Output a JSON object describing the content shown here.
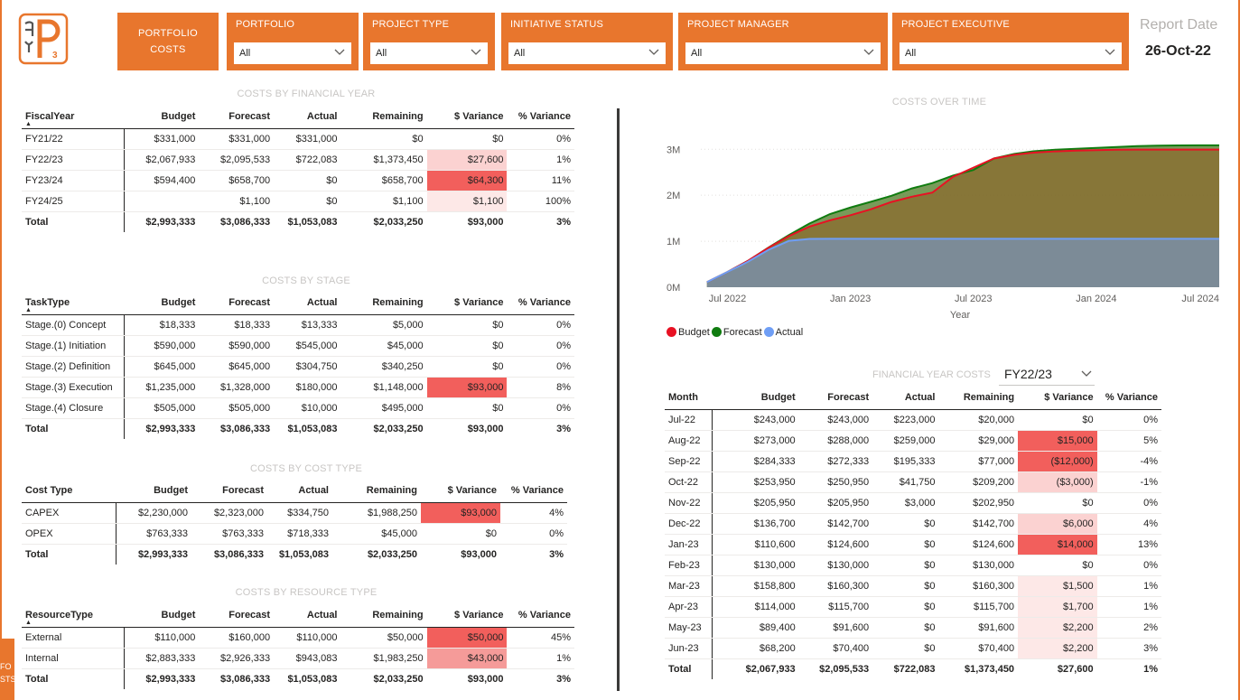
{
  "logo": {
    "text": "myP3",
    "icon": "myp3-logo-icon"
  },
  "header": {
    "portfolio_costs_line1": "PORTFOLIO",
    "portfolio_costs_line2": "COSTS",
    "filters": [
      {
        "label": "PORTFOLIO",
        "value": "All"
      },
      {
        "label": "PROJECT TYPE",
        "value": "All"
      },
      {
        "label": "INITIATIVE STATUS",
        "value": "All"
      },
      {
        "label": "PROJECT MANAGER",
        "value": "All"
      },
      {
        "label": "PROJECT EXECUTIVE",
        "value": "All"
      }
    ],
    "report_date_label": "Report Date",
    "report_date_value": "26-Oct-22"
  },
  "colors": {
    "accent": "#e8762d",
    "budget": "#e81123",
    "forecast": "#107c10",
    "actual": "#6f9ef5"
  },
  "fy_table": {
    "title": "COSTS BY FINANCIAL YEAR",
    "columns": [
      "FiscalYear",
      "Budget",
      "Forecast",
      "Actual",
      "Remaining",
      "$ Variance",
      "% Variance"
    ],
    "rows": [
      [
        "FY21/22",
        "$331,000",
        "$331,000",
        "$331,000",
        "$0",
        "$0",
        "0%"
      ],
      [
        "FY22/23",
        "$2,067,933",
        "$2,095,533",
        "$722,083",
        "$1,373,450",
        "$27,600",
        "1%"
      ],
      [
        "FY23/24",
        "$594,400",
        "$658,700",
        "$0",
        "$658,700",
        "$64,300",
        "11%"
      ],
      [
        "FY24/25",
        "",
        "$1,100",
        "$0",
        "$1,100",
        "$1,100",
        "100%"
      ]
    ],
    "total": [
      "Total",
      "$2,993,333",
      "$3,086,333",
      "$1,053,083",
      "$2,033,250",
      "$93,000",
      "3%"
    ]
  },
  "stage_table": {
    "title": "COSTS BY STAGE",
    "columns": [
      "TaskType",
      "Budget",
      "Forecast",
      "Actual",
      "Remaining",
      "$ Variance",
      "% Variance"
    ],
    "rows": [
      [
        "Stage.(0) Concept",
        "$18,333",
        "$18,333",
        "$13,333",
        "$5,000",
        "$0",
        "0%"
      ],
      [
        "Stage.(1) Initiation",
        "$590,000",
        "$590,000",
        "$545,000",
        "$45,000",
        "$0",
        "0%"
      ],
      [
        "Stage.(2) Definition",
        "$645,000",
        "$645,000",
        "$304,750",
        "$340,250",
        "$0",
        "0%"
      ],
      [
        "Stage.(3) Execution",
        "$1,235,000",
        "$1,328,000",
        "$180,000",
        "$1,148,000",
        "$93,000",
        "8%"
      ],
      [
        "Stage.(4) Closure",
        "$505,000",
        "$505,000",
        "$10,000",
        "$495,000",
        "$0",
        "0%"
      ]
    ],
    "total": [
      "Total",
      "$2,993,333",
      "$3,086,333",
      "$1,053,083",
      "$2,033,250",
      "$93,000",
      "3%"
    ]
  },
  "cost_type_table": {
    "title": "COSTS BY COST TYPE",
    "columns": [
      "Cost Type",
      "Budget",
      "Forecast",
      "Actual",
      "Remaining",
      "$ Variance",
      "% Variance"
    ],
    "rows": [
      [
        "CAPEX",
        "$2,230,000",
        "$2,323,000",
        "$334,750",
        "$1,988,250",
        "$93,000",
        "4%"
      ],
      [
        "OPEX",
        "$763,333",
        "$763,333",
        "$718,333",
        "$45,000",
        "$0",
        "0%"
      ]
    ],
    "total": [
      "Total",
      "$2,993,333",
      "$3,086,333",
      "$1,053,083",
      "$2,033,250",
      "$93,000",
      "3%"
    ]
  },
  "resource_table": {
    "title": "COSTS BY RESOURCE TYPE",
    "columns": [
      "ResourceType",
      "Budget",
      "Forecast",
      "Actual",
      "Remaining",
      "$ Variance",
      "% Variance"
    ],
    "rows": [
      [
        "External",
        "$110,000",
        "$160,000",
        "$110,000",
        "$50,000",
        "$50,000",
        "45%"
      ],
      [
        "Internal",
        "$2,883,333",
        "$2,926,333",
        "$943,083",
        "$1,983,250",
        "$43,000",
        "1%"
      ]
    ],
    "total": [
      "Total",
      "$2,993,333",
      "$3,086,333",
      "$1,053,083",
      "$2,033,250",
      "$93,000",
      "3%"
    ]
  },
  "chart": {
    "title": "COSTS OVER TIME",
    "xlabel": "Year",
    "legend": [
      "Budget",
      "Forecast",
      "Actual"
    ]
  },
  "chart_data": {
    "type": "area",
    "title": "COSTS OVER TIME",
    "xlabel": "Year",
    "ylabel": "",
    "x_ticks": [
      "Jul 2022",
      "Jan 2023",
      "Jul 2023",
      "Jan 2024",
      "Jul 2024"
    ],
    "y_ticks": [
      "0M",
      "1M",
      "2M",
      "3M"
    ],
    "ylim": [
      0,
      3300000
    ],
    "x": [
      "2022-06",
      "2022-07",
      "2022-08",
      "2022-09",
      "2022-10",
      "2022-11",
      "2022-12",
      "2023-01",
      "2023-02",
      "2023-03",
      "2023-04",
      "2023-05",
      "2023-06",
      "2023-07",
      "2023-08",
      "2023-09",
      "2023-10",
      "2023-11",
      "2023-12",
      "2024-01",
      "2024-02",
      "2024-03",
      "2024-04",
      "2024-05",
      "2024-06",
      "2024-07"
    ],
    "series": [
      {
        "name": "Budget",
        "values": [
          110000,
          331000,
          574000,
          858333,
          1112283,
          1318233,
          1454933,
          1565533,
          1695533,
          1854333,
          1968333,
          2057733,
          2400000,
          2600000,
          2800000,
          2880000,
          2930000,
          2955000,
          2970000,
          2980000,
          2990000,
          2993000,
          2993000,
          2993000,
          2993333,
          2993333
        ]
      },
      {
        "name": "Forecast",
        "values": [
          110000,
          331000,
          574000,
          862000,
          1134000,
          1385000,
          1591000,
          1733700,
          1858300,
          1988300,
          2148600,
          2264300,
          2426500,
          2550000,
          2800000,
          2900000,
          2960000,
          2990000,
          3010000,
          3030000,
          3050000,
          3070000,
          3080000,
          3085000,
          3086000,
          3086333
        ]
      },
      {
        "name": "Actual",
        "values": [
          110000,
          331000,
          554000,
          813000,
          1008333,
          1050083,
          1053083,
          1053083,
          1053083,
          1053083,
          1053083,
          1053083,
          1053083,
          1053083,
          1053083,
          1053083,
          1053083,
          1053083,
          1053083,
          1053083,
          1053083,
          1053083,
          1053083,
          1053083,
          1053083,
          1053083
        ]
      }
    ]
  },
  "fy_costs": {
    "title": "FINANCIAL YEAR COSTS",
    "selected": "FY22/23",
    "columns": [
      "Month",
      "Budget",
      "Forecast",
      "Actual",
      "Remaining",
      "$ Variance",
      "% Variance"
    ],
    "rows": [
      [
        "Jul-22",
        "$243,000",
        "$243,000",
        "$223,000",
        "$20,000",
        "$0",
        "0%"
      ],
      [
        "Aug-22",
        "$273,000",
        "$288,000",
        "$259,000",
        "$29,000",
        "$15,000",
        "5%"
      ],
      [
        "Sep-22",
        "$284,333",
        "$272,333",
        "$195,333",
        "$77,000",
        "($12,000)",
        "-4%"
      ],
      [
        "Oct-22",
        "$253,950",
        "$250,950",
        "$41,750",
        "$209,200",
        "($3,000)",
        "-1%"
      ],
      [
        "Nov-22",
        "$205,950",
        "$205,950",
        "$3,000",
        "$202,950",
        "$0",
        "0%"
      ],
      [
        "Dec-22",
        "$136,700",
        "$142,700",
        "$0",
        "$142,700",
        "$6,000",
        "4%"
      ],
      [
        "Jan-23",
        "$110,600",
        "$124,600",
        "$0",
        "$124,600",
        "$14,000",
        "13%"
      ],
      [
        "Feb-23",
        "$130,000",
        "$130,000",
        "$0",
        "$130,000",
        "$0",
        "0%"
      ],
      [
        "Mar-23",
        "$158,800",
        "$160,300",
        "$0",
        "$160,300",
        "$1,500",
        "1%"
      ],
      [
        "Apr-23",
        "$114,000",
        "$115,700",
        "$0",
        "$115,700",
        "$1,700",
        "1%"
      ],
      [
        "May-23",
        "$89,400",
        "$91,600",
        "$0",
        "$91,600",
        "$2,200",
        "2%"
      ],
      [
        "Jun-23",
        "$68,200",
        "$70,400",
        "$0",
        "$70,400",
        "$2,200",
        "3%"
      ]
    ],
    "total": [
      "Total",
      "$2,067,933",
      "$2,095,533",
      "$722,083",
      "$1,373,450",
      "$27,600",
      "1%"
    ]
  },
  "side_tab": {
    "line1": "FO",
    "line2": "STS"
  }
}
